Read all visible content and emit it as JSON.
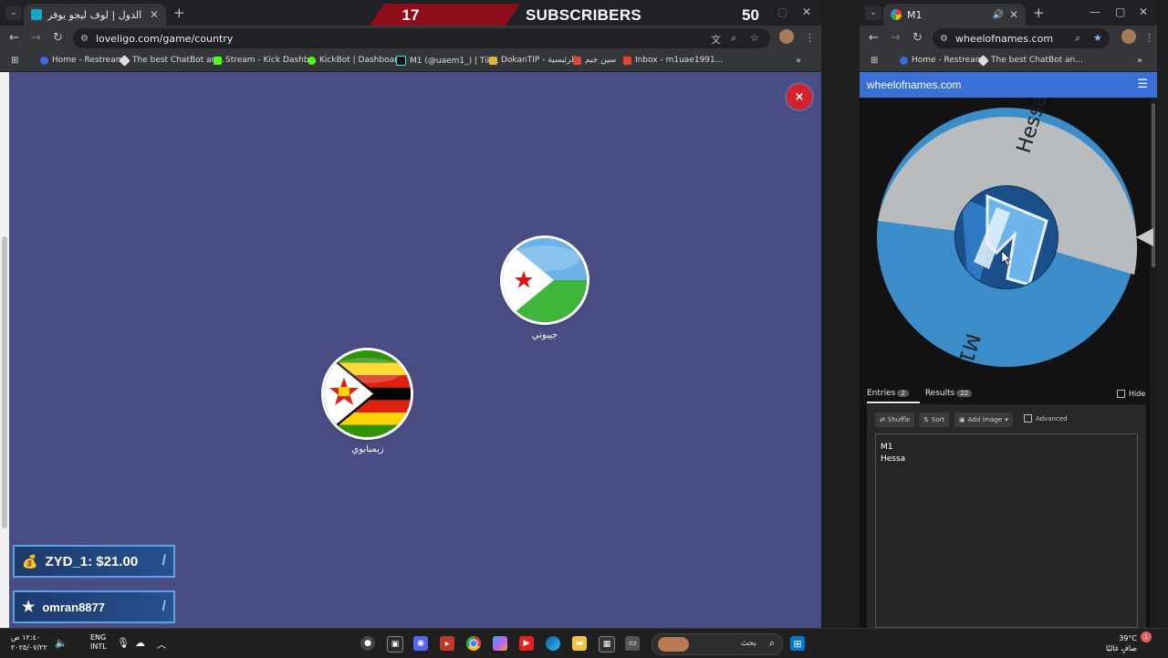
{
  "left_browser": {
    "tab_title": "لعبة حرب الدول | لوف ليجو يوفر",
    "url": "loveligo.com/game/country",
    "bookmarks": [
      "Home - Restream",
      "The best ChatBot an...",
      "Stream - Kick Dashb...",
      "KickBot | Dashboard",
      "M1 (@uaem1_) | Tik...",
      "DokanTIP - الرئيسية",
      "سين جيم",
      "Inbox - m1uae1991..."
    ]
  },
  "subscribers": {
    "count_left": "17",
    "label": "SUBSCRIBERS",
    "count_right": "50"
  },
  "game": {
    "countries": [
      {
        "name": "جيبوتي",
        "flag": "djibouti"
      },
      {
        "name": "زيمبابوي",
        "flag": "zimbabwe"
      }
    ],
    "close_label": "×"
  },
  "alerts": [
    {
      "icon": "money-bag-icon",
      "text": "ZYD_1: $21.00"
    },
    {
      "icon": "star-icon",
      "text": "omran8877"
    }
  ],
  "right_browser": {
    "tab_title": "M1",
    "url": "wheelofnames.com",
    "bookmarks": [
      "Home - Restream",
      "The best ChatBot an..."
    ],
    "site_title": "wheelofnames.com",
    "wheel_entries": [
      "Hessa",
      "M1"
    ],
    "tabs": [
      {
        "label": "Entries",
        "count": "2"
      },
      {
        "label": "Results",
        "count": "22"
      }
    ],
    "hide_label": "Hide",
    "toolbar": {
      "shuffle": "Shuffle",
      "sort": "Sort",
      "add_image": "Add image",
      "advanced": "Advanced"
    },
    "entries_text": [
      "M1",
      "Hessa"
    ]
  },
  "taskbar": {
    "time": "١٢:٤٠ ص",
    "date": "٢٠٢٥/٠٧/٢٢",
    "lang_line1": "ENG",
    "lang_line2": "INTL",
    "search_placeholder": "بحث",
    "weather_temp": "39°C",
    "weather_desc": "صافٍ غالبًا",
    "notification_count": "1"
  },
  "colors": {
    "game_bg": "#4a4d83",
    "subscriber_red": "#8f0d18",
    "wheel_grey": "#b8bcbe",
    "wheel_blue": "#3a8dc8",
    "header_blue": "#3b6fd8"
  }
}
